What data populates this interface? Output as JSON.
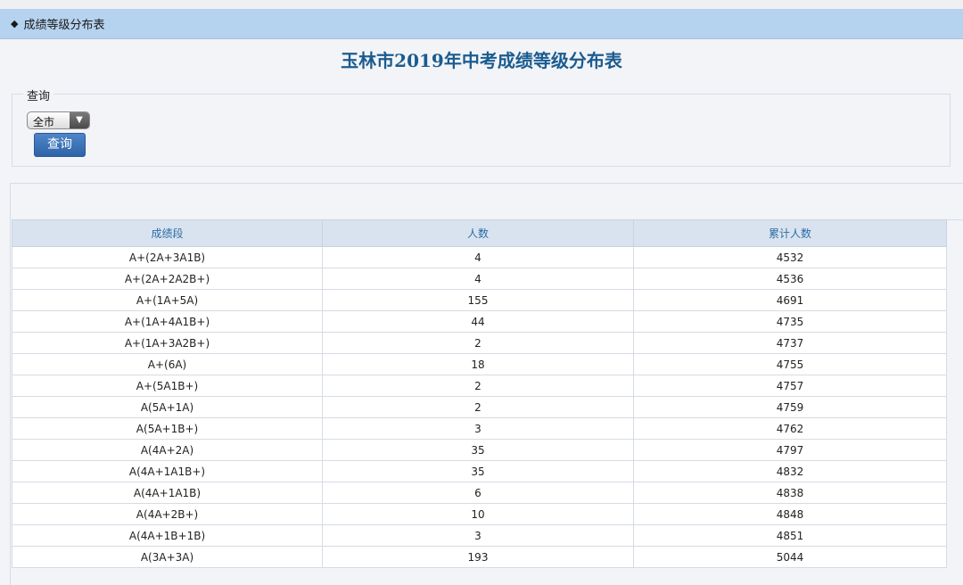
{
  "header": {
    "icon": "diamond-icon",
    "title": "成绩等级分布表"
  },
  "page_title": "玉林市2019年中考成绩等级分布表",
  "query": {
    "legend": "查询",
    "select_value": "全市",
    "button_label": "查询"
  },
  "table": {
    "columns": [
      "成绩段",
      "人数",
      "累计人数"
    ],
    "rows": [
      [
        "A+(2A+3A1B)",
        "4",
        "4532"
      ],
      [
        "A+(2A+2A2B+)",
        "4",
        "4536"
      ],
      [
        "A+(1A+5A)",
        "155",
        "4691"
      ],
      [
        "A+(1A+4A1B+)",
        "44",
        "4735"
      ],
      [
        "A+(1A+3A2B+)",
        "2",
        "4737"
      ],
      [
        "A+(6A)",
        "18",
        "4755"
      ],
      [
        "A+(5A1B+)",
        "2",
        "4757"
      ],
      [
        "A(5A+1A)",
        "2",
        "4759"
      ],
      [
        "A(5A+1B+)",
        "3",
        "4762"
      ],
      [
        "A(4A+2A)",
        "35",
        "4797"
      ],
      [
        "A(4A+1A1B+)",
        "35",
        "4832"
      ],
      [
        "A(4A+1A1B)",
        "6",
        "4838"
      ],
      [
        "A(4A+2B+)",
        "10",
        "4848"
      ],
      [
        "A(4A+1B+1B)",
        "3",
        "4851"
      ],
      [
        "A(3A+3A)",
        "193",
        "5044"
      ]
    ]
  },
  "colors": {
    "header_bar": "#b5d2ee",
    "title": "#1b5c8f",
    "button": "#2e63a8",
    "table_header": "#d9e3ef"
  }
}
